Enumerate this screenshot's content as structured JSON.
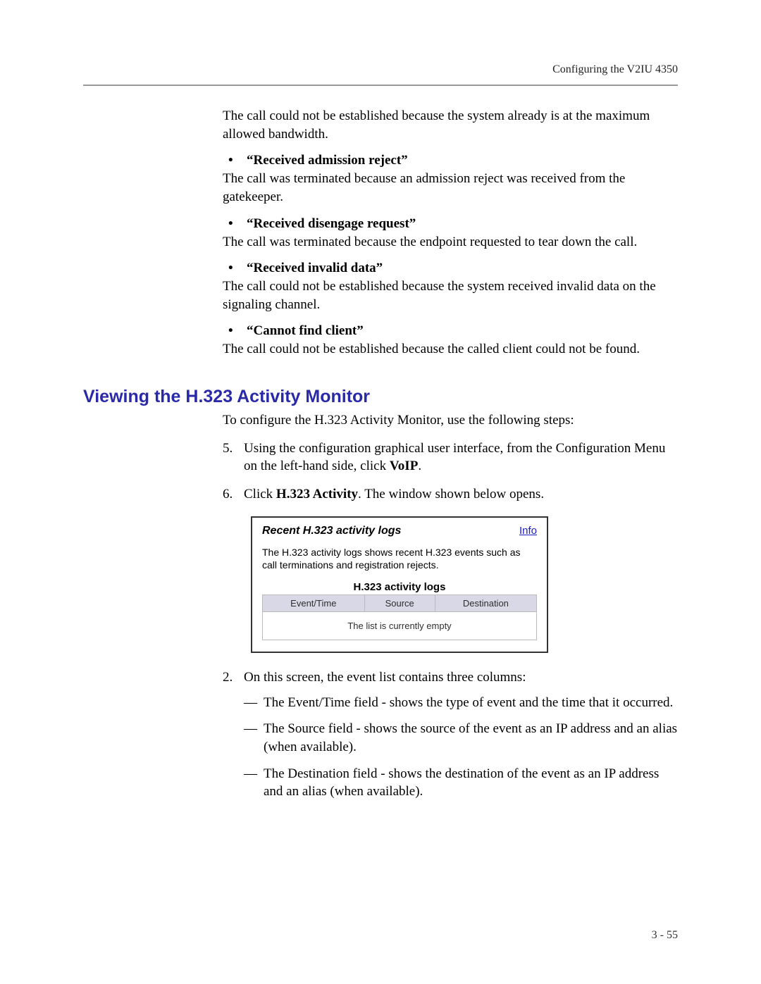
{
  "header": {
    "running": "Configuring the V2IU 4350"
  },
  "intro_para": "The call could not be established because the system already is at the maximum allowed bandwidth.",
  "messages": [
    {
      "title": "“Received admission reject”",
      "desc": "The call was terminated because an admission reject was received from the gatekeeper."
    },
    {
      "title": "“Received disengage request”",
      "desc": "The call was terminated because the endpoint requested to tear down the call."
    },
    {
      "title": "“Received invalid data”",
      "desc": "The call could not be established because the system received invalid data on the signaling channel."
    },
    {
      "title": "“Cannot find client”",
      "desc": "The call could not be established because the called client could not be found."
    }
  ],
  "section_title": "Viewing the H.323 Activity Monitor",
  "section_intro": "To configure the H.323 Activity Monitor, use the following steps:",
  "steps_top": [
    {
      "pre": "Using the configuration graphical user interface, from the Configuration Menu on the left-hand side, click ",
      "bold": "VoIP",
      "post": "."
    },
    {
      "pre": "Click ",
      "bold": "H.323 Activity",
      "post": ". The window shown below opens."
    }
  ],
  "figure": {
    "title": "Recent H.323 activity logs",
    "info": "Info",
    "desc": "The H.323 activity logs shows recent H.323 events such as call terminations and registration rejects.",
    "table_title": "H.323 activity logs",
    "cols": [
      "Event/Time",
      "Source",
      "Destination"
    ],
    "empty": "The list is currently empty"
  },
  "steps_bottom": [
    {
      "text": "On this screen, the event list contains three columns:",
      "subs": [
        "The Event/Time field - shows the type of event and the time that it occurred.",
        "The Source field - shows the source of the event as an IP address and an alias (when available).",
        "The Destination field - shows the destination of the event as an IP address and an alias (when available)."
      ]
    }
  ],
  "footer": "3 - 55"
}
